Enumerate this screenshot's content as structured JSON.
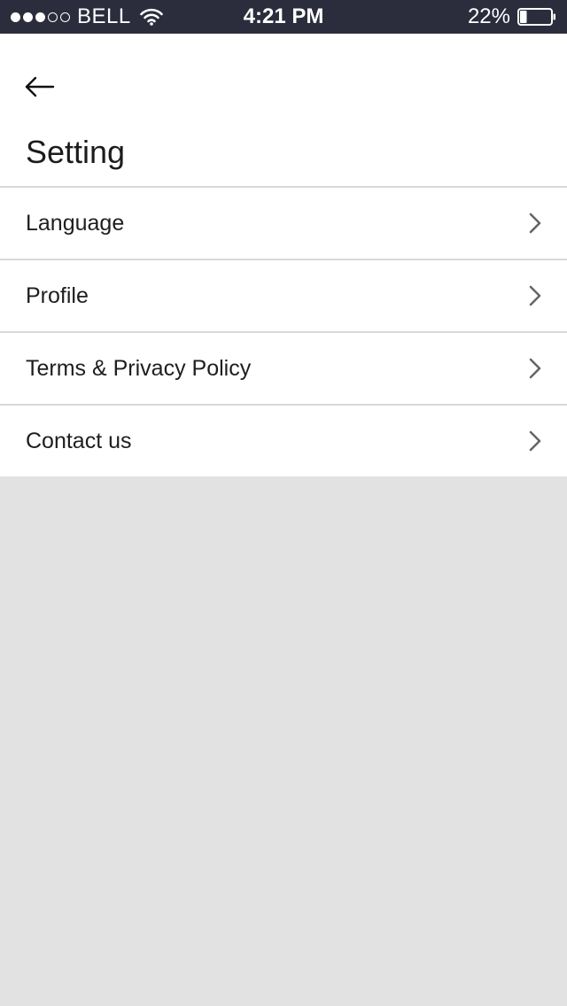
{
  "status_bar": {
    "signal_strength": 3,
    "signal_max": 5,
    "carrier": "BELL",
    "time": "4:21 PM",
    "battery_percent_label": "22%",
    "battery_level": 0.22,
    "background_color": "#2c2d3c"
  },
  "header": {
    "back_icon": "arrow-left-icon",
    "title": "Setting"
  },
  "settings": {
    "items": [
      {
        "label": "Language",
        "icon": "chevron-right-icon"
      },
      {
        "label": "Profile",
        "icon": "chevron-right-icon"
      },
      {
        "label": "Terms & Privacy Policy",
        "icon": "chevron-right-icon"
      },
      {
        "label": "Contact us",
        "icon": "chevron-right-icon"
      }
    ]
  },
  "colors": {
    "page_background": "#e2e2e2",
    "divider": "#d9d9d9",
    "text": "#1e1e1e",
    "chevron": "#666666"
  }
}
